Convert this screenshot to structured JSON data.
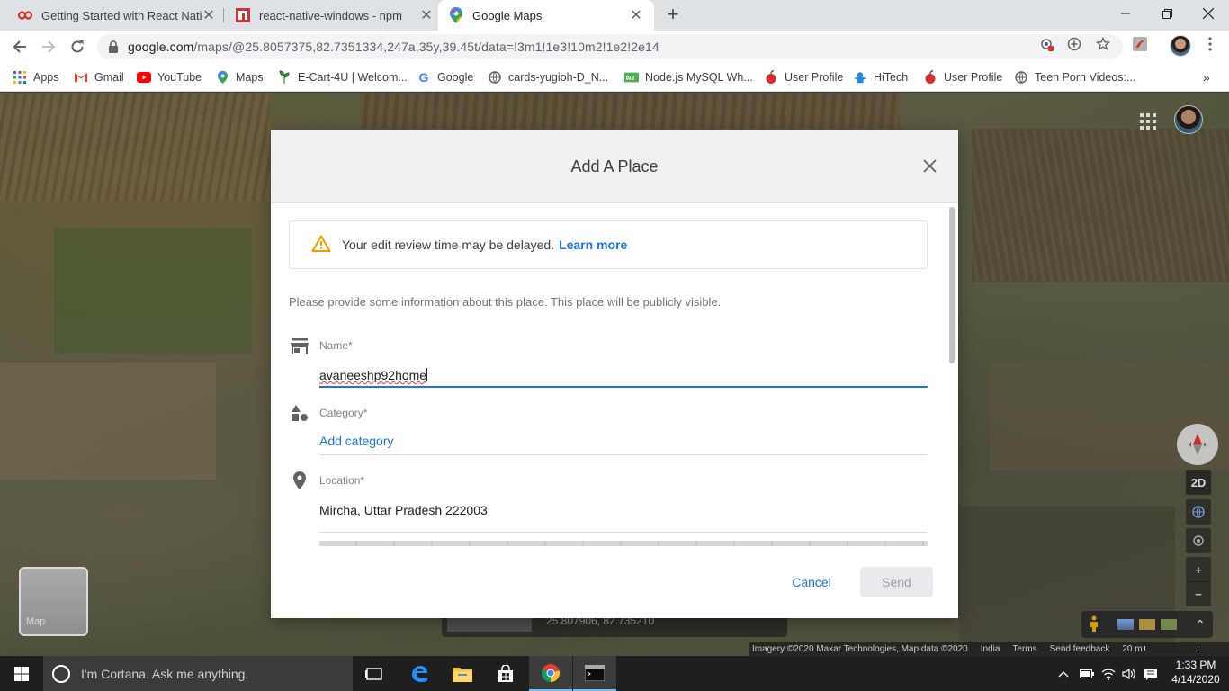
{
  "browser": {
    "tabs": [
      {
        "label": "Getting Started with React Native",
        "icon": "cc-icon"
      },
      {
        "label": "react-native-windows - npm",
        "icon": "npm-icon"
      },
      {
        "label": "Google Maps",
        "icon": "maps-pin-icon"
      }
    ],
    "url_host": "google.com",
    "url_path": "/maps/@25.8057375,82.7351334,247a,35y,39.45t/data=!3m1!1e3!10m2!1e2!2e14"
  },
  "bookmarks": [
    {
      "label": "Apps"
    },
    {
      "label": "Gmail"
    },
    {
      "label": "YouTube"
    },
    {
      "label": "Maps"
    },
    {
      "label": "E-Cart-4U | Welcom..."
    },
    {
      "label": "Google"
    },
    {
      "label": "cards-yugioh-D_N..."
    },
    {
      "label": "Node.js MySQL Wh..."
    },
    {
      "label": "User Profile"
    },
    {
      "label": "HiTech"
    },
    {
      "label": "User Profile"
    },
    {
      "label": "Teen Porn Videos:..."
    }
  ],
  "dialog": {
    "title": "Add A Place",
    "warning_text": "Your edit review time may be delayed.",
    "warning_link": "Learn more",
    "intro": "Please provide some information about this place. This place will be publicly visible.",
    "name_label": "Name*",
    "name_value": "avaneeshp92home",
    "category_label": "Category*",
    "category_action": "Add category",
    "location_label": "Location*",
    "location_value": "Mircha, Uttar Pradesh 222003",
    "cancel_label": "Cancel",
    "send_label": "Send"
  },
  "map": {
    "view_mode_button": "2D",
    "minimap_label": "Map",
    "coordinates": "25.807906, 82.735210",
    "footer": {
      "imagery": "Imagery ©2020 Maxar Technologies, Map data ©2020",
      "region": "India",
      "terms": "Terms",
      "feedback": "Send feedback",
      "scale": "20 m"
    }
  },
  "taskbar": {
    "search_placeholder": "I'm Cortana. Ask me anything.",
    "time": "1:33 PM",
    "date": "4/14/2020"
  },
  "colors": {
    "accent": "#1a73e8",
    "warning": "#f29900",
    "send_disabled_bg": "#e8eaed"
  }
}
